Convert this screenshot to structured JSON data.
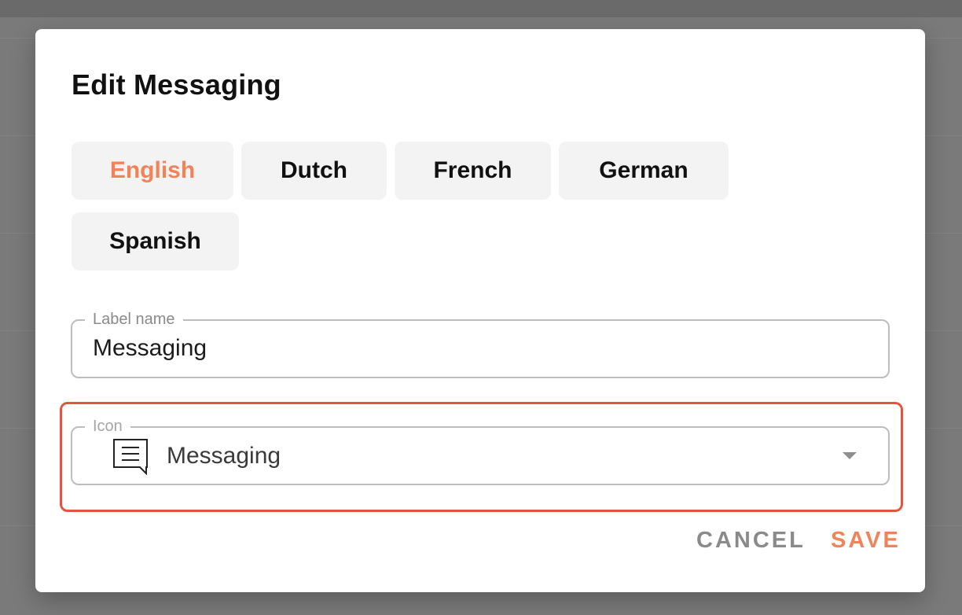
{
  "dialog": {
    "title": "Edit Messaging",
    "languages": [
      {
        "label": "English",
        "active": true
      },
      {
        "label": "Dutch",
        "active": false
      },
      {
        "label": "French",
        "active": false
      },
      {
        "label": "German",
        "active": false
      },
      {
        "label": "Spanish",
        "active": false
      }
    ],
    "label_field": {
      "legend": "Label name",
      "value": "Messaging"
    },
    "icon_field": {
      "legend": "Icon",
      "value": "Messaging",
      "icon": "message-square-icon"
    },
    "actions": {
      "cancel": "CANCEL",
      "save": "SAVE"
    }
  },
  "colors": {
    "accent": "#f08458",
    "highlight": "#e0573f",
    "overlay": "#7a7a7a",
    "tab_bg": "#f3f3f3"
  }
}
